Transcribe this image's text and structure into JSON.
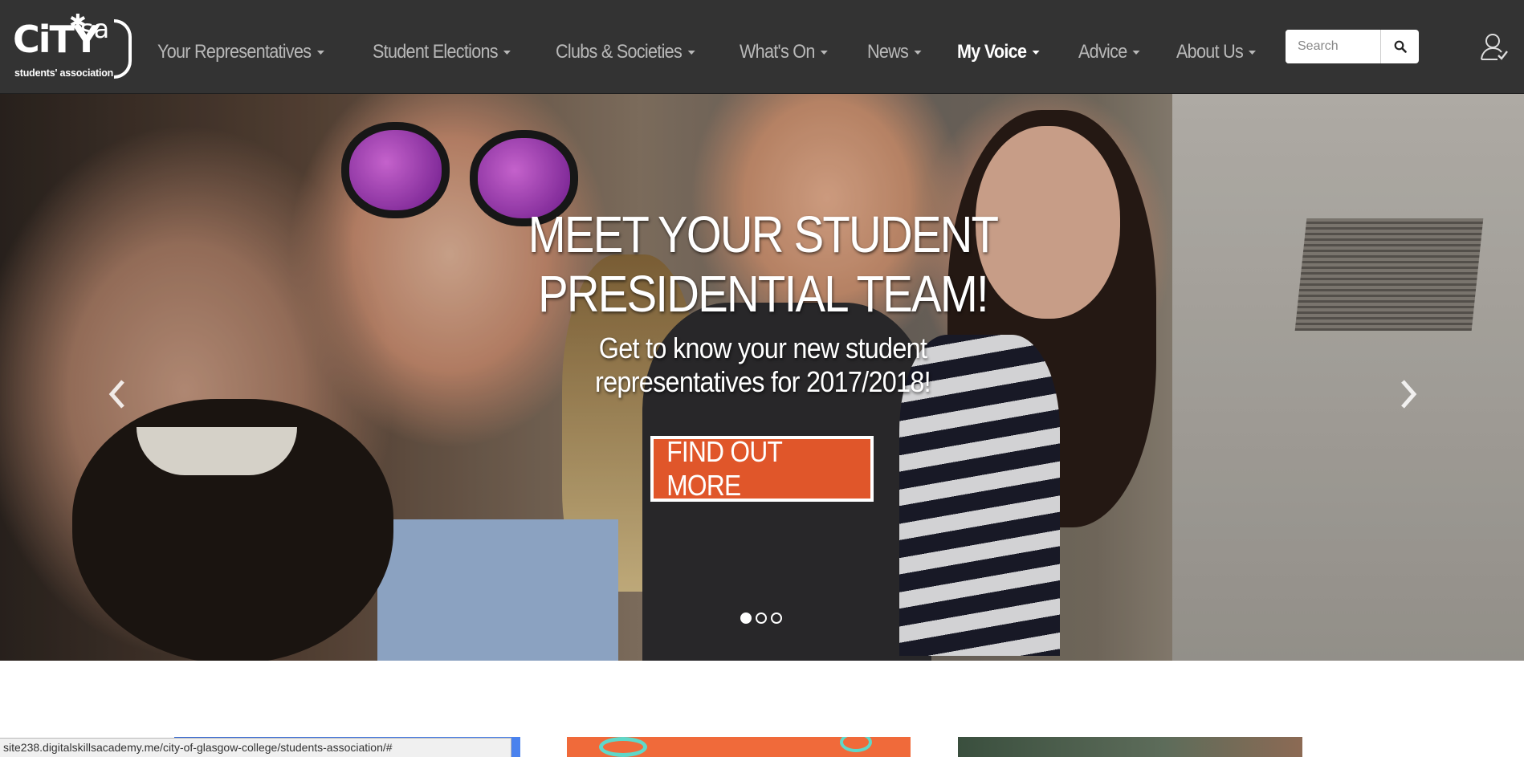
{
  "logo": {
    "main": "CiTY",
    "sa": "sa",
    "tagline": "students' association"
  },
  "nav": {
    "items": [
      {
        "label": "Your Representatives",
        "active": false
      },
      {
        "label": "Student Elections",
        "active": false
      },
      {
        "label": "Clubs & Societies",
        "active": false
      },
      {
        "label": "What's On",
        "active": false
      },
      {
        "label": "News",
        "active": false
      },
      {
        "label": "My Voice",
        "active": true
      },
      {
        "label": "Advice",
        "active": false
      },
      {
        "label": "About Us",
        "active": false
      }
    ]
  },
  "search": {
    "placeholder": "Search",
    "icon": "search-icon"
  },
  "account": {
    "icon": "user-check-icon"
  },
  "hero": {
    "title_line1": "MEET YOUR STUDENT",
    "title_line2": "PRESIDENTIAL TEAM!",
    "subtitle_line1": "Get to know your new student",
    "subtitle_line2": "representatives for 2017/2018!",
    "cta_label": "FIND OUT MORE",
    "slide_count": 3,
    "active_slide": 1
  },
  "colors": {
    "navbar_bg": "#333333",
    "nav_text": "#b8b8b8",
    "nav_active": "#ffffff",
    "cta_bg": "#e0562a"
  },
  "statusbar": {
    "url": "site238.digitalskillsacademy.me/city-of-glasgow-college/students-association/#"
  }
}
